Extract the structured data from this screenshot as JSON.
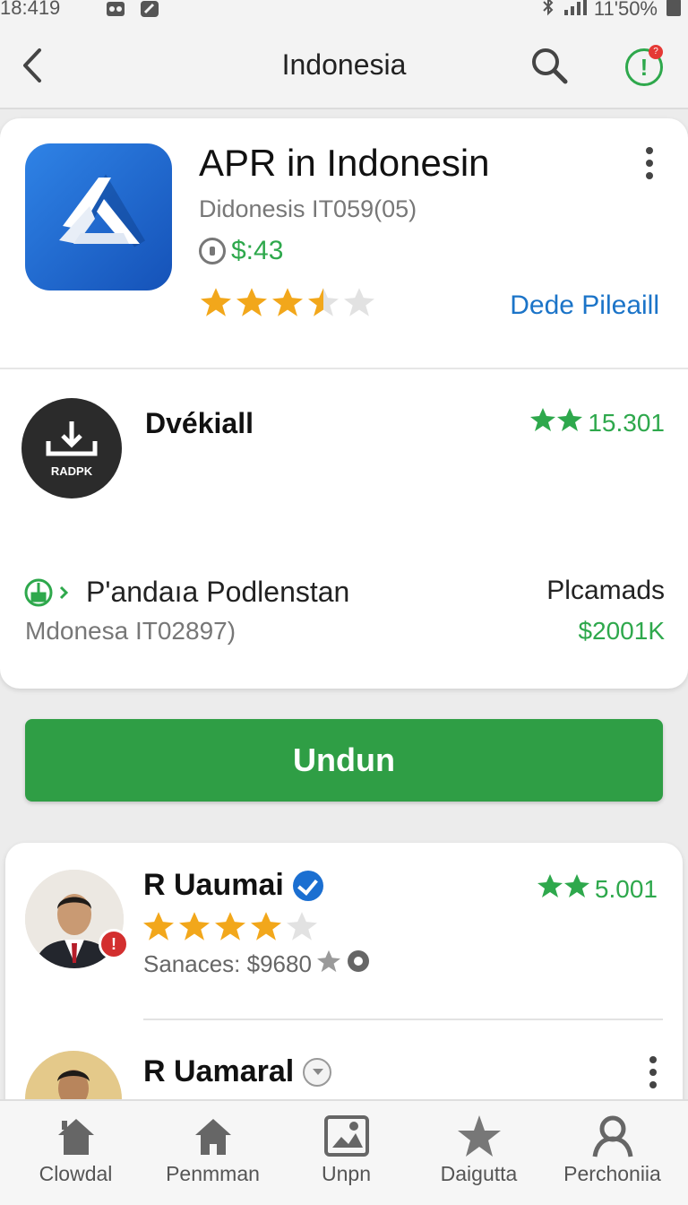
{
  "status_bar": {
    "time": "18:419",
    "battery": "11'50%"
  },
  "app_bar": {
    "title": "Indonesia",
    "alert_badge": "?"
  },
  "app_card": {
    "title": "APR in Indonesin",
    "subtitle": "Didonesis IT059(05)",
    "price": "$:43",
    "rating": 3.5,
    "link": "Dede Pileaill"
  },
  "download_row": {
    "icon_label": "RADPK",
    "title": "Dvékiall",
    "stat": "15.301",
    "plugin_name": "P'andaıa Podlenstan",
    "plugin_sub": "Mdonesa IT02897)",
    "right_label": "Plcamads",
    "right_price": "$2001K"
  },
  "primary_button": {
    "label": "Undun"
  },
  "reviews": [
    {
      "name": "R Uaumai",
      "stat": "5.001",
      "rating": 4,
      "sub": "Sanaces: $9680"
    },
    {
      "name": "R Uamaral"
    }
  ],
  "bottom_nav": [
    {
      "label": "Clowdal",
      "icon": "home-icon"
    },
    {
      "label": "Penmman",
      "icon": "home-icon"
    },
    {
      "label": "Unpn",
      "icon": "image-icon"
    },
    {
      "label": "Daigutta",
      "icon": "star-icon"
    },
    {
      "label": "Perchoniia",
      "icon": "person-icon"
    }
  ],
  "colors": {
    "accent_green": "#2ea84c",
    "button_green": "#2f9e45",
    "link_blue": "#1b74c8",
    "star_gold": "#f2a71b"
  }
}
